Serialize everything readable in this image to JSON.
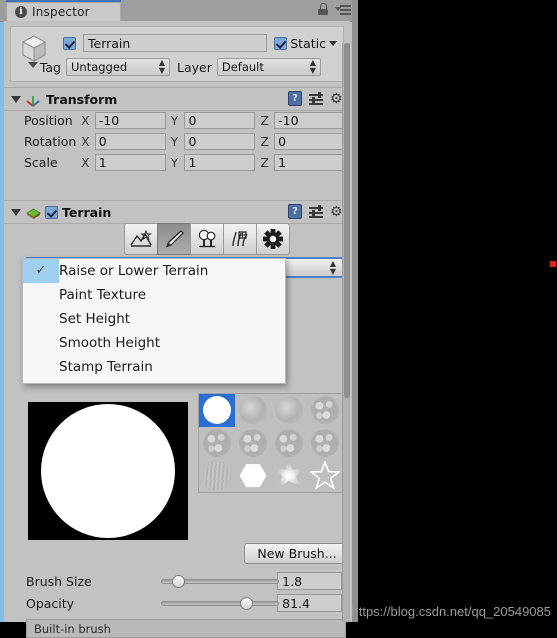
{
  "window": {
    "tab_label": "Inspector",
    "info_icon": "info-icon",
    "lock_icon": "lock-icon",
    "menu_icon": "hamburger-menu-icon"
  },
  "object_header": {
    "enabled_checkbox": true,
    "name_value": "Terrain",
    "static_label": "Static",
    "static_checked": true,
    "tag_label": "Tag",
    "tag_value": "Untagged",
    "layer_label": "Layer",
    "layer_value": "Default",
    "stepper_glyph": "↕"
  },
  "transform": {
    "title": "Transform",
    "rows": [
      {
        "label": "Position",
        "x": "-10",
        "y": "0",
        "z": "-10"
      },
      {
        "label": "Rotation",
        "x": "0",
        "y": "0",
        "z": "0"
      },
      {
        "label": "Scale",
        "x": "1",
        "y": "1",
        "z": "1"
      }
    ],
    "axis_x": "X",
    "axis_y": "Y",
    "axis_z": "Z",
    "help_glyph": "?",
    "gear_glyph": "⚙"
  },
  "terrain": {
    "title": "Terrain",
    "enabled_checkbox": true,
    "toolbar": [
      {
        "name": "create-neighbor-terrains-tool",
        "active": false
      },
      {
        "name": "paint-terrain-tool",
        "active": true
      },
      {
        "name": "paint-trees-tool",
        "active": false
      },
      {
        "name": "paint-details-tool",
        "active": false
      },
      {
        "name": "terrain-settings-tool",
        "active": false
      }
    ],
    "dropdown_value": "Raise or Lower Terrain",
    "dropdown_options": [
      "Raise or Lower Terrain",
      "Paint Texture",
      "Set Height",
      "Smooth Height",
      "Stamp Terrain"
    ],
    "dropdown_selected_index": 0,
    "check_glyph": "✓",
    "brushes": [
      {
        "shape": "circle-brush",
        "selected": true
      },
      {
        "shape": "soft-blob-brush",
        "selected": false
      },
      {
        "shape": "soft-blob-brush",
        "selected": false
      },
      {
        "shape": "noisy-blob-brush",
        "selected": false
      },
      {
        "shape": "noisy-blob-brush",
        "selected": false
      },
      {
        "shape": "noisy-blob-brush",
        "selected": false
      },
      {
        "shape": "noisy-blob-brush",
        "selected": false
      },
      {
        "shape": "noisy-blob-brush",
        "selected": false
      },
      {
        "shape": "streak-brush",
        "selected": false
      },
      {
        "shape": "hexagon-brush",
        "selected": false
      },
      {
        "shape": "six-point-star-brush",
        "selected": false
      },
      {
        "shape": "five-point-star-brush",
        "selected": false
      }
    ],
    "new_brush_label": "New Brush...",
    "brush_size_label": "Brush Size",
    "brush_size_value": "1.8",
    "brush_size_percent": 10,
    "opacity_label": "Opacity",
    "opacity_value": "81.4",
    "opacity_percent": 75,
    "builtin_label": "Built-in brush"
  },
  "watermark": "https://blog.csdn.net/qq_20549085",
  "colors": {
    "panel_bg": "#c2c2c2",
    "accent_blue": "#2b6fd4",
    "focus_blue": "#4a80c8",
    "selection_blue": "#9fd0f0",
    "red_marker": "#e02020"
  }
}
